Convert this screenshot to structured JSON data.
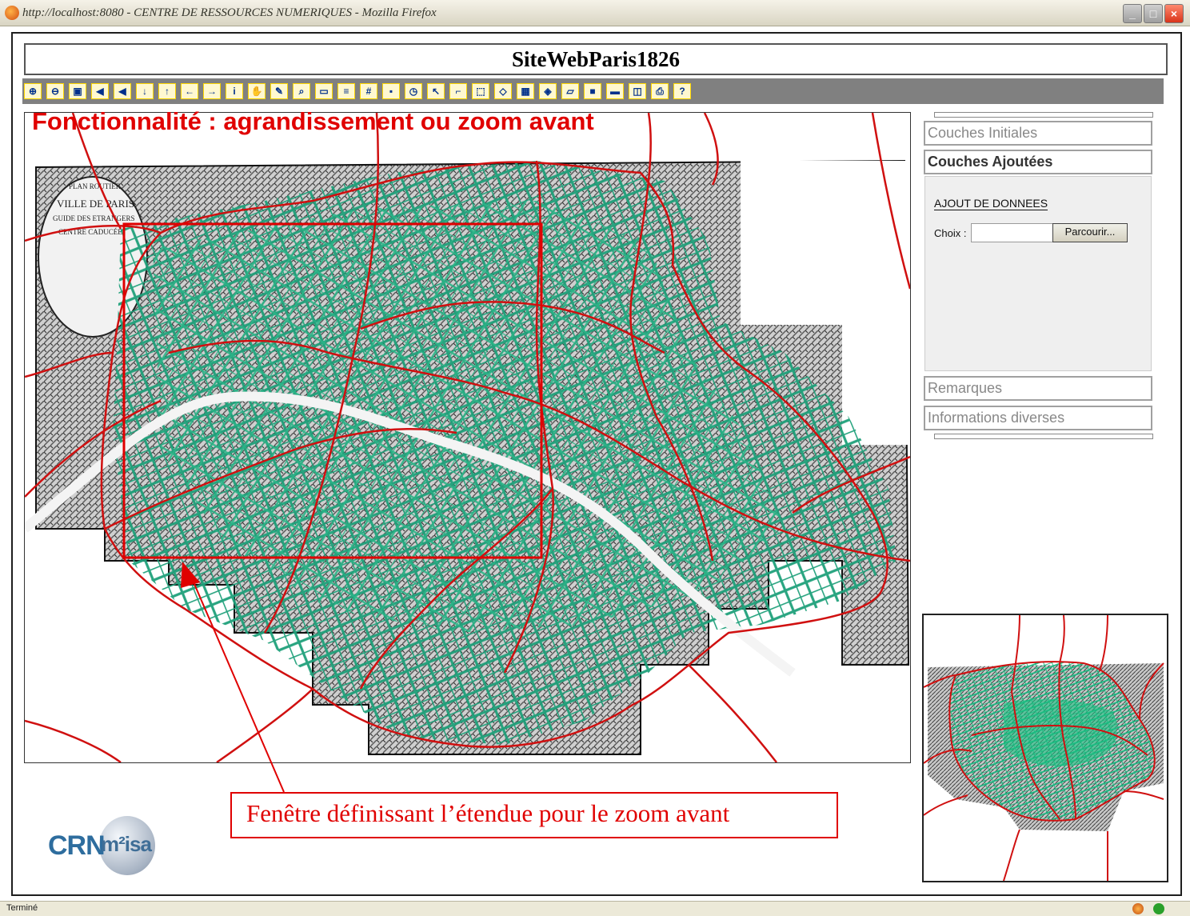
{
  "window": {
    "title": "http://localhost:8080 - CENTRE DE RESSOURCES NUMERIQUES - Mozilla Firefox",
    "status": "Terminé"
  },
  "page": {
    "site_title": "SiteWebParis1826",
    "feature_caption": "Fonctionnalité : agrandissement ou zoom avant",
    "callout_text": "Fenêtre définissant l’étendue pour le zoom avant"
  },
  "toolbar": {
    "tools": [
      {
        "icon": "zoom-in-icon",
        "glyph": "⊕"
      },
      {
        "icon": "zoom-out-icon",
        "glyph": "⊖"
      },
      {
        "icon": "zoom-extent-icon",
        "glyph": "▣"
      },
      {
        "icon": "previous-extent-icon",
        "glyph": "◀"
      },
      {
        "icon": "next-extent-icon",
        "glyph": "◀"
      },
      {
        "icon": "pan-down-icon",
        "glyph": "↓"
      },
      {
        "icon": "pan-up-icon",
        "glyph": "↑"
      },
      {
        "icon": "pan-left-icon",
        "glyph": "←"
      },
      {
        "icon": "pan-right-icon",
        "glyph": "→"
      },
      {
        "icon": "info-icon",
        "glyph": "i"
      },
      {
        "icon": "pan-hand-icon",
        "glyph": "✋"
      },
      {
        "icon": "edit-icon",
        "glyph": "✎"
      },
      {
        "icon": "find-icon",
        "glyph": "⌕"
      },
      {
        "icon": "measure-icon",
        "glyph": "▭"
      },
      {
        "icon": "list-icon",
        "glyph": "≡"
      },
      {
        "icon": "grid-icon",
        "glyph": "#"
      },
      {
        "icon": "bookmark-icon",
        "glyph": "▪"
      },
      {
        "icon": "clock-icon",
        "glyph": "◷"
      },
      {
        "icon": "select-icon",
        "glyph": "↖"
      },
      {
        "icon": "select-line-icon",
        "glyph": "⌐"
      },
      {
        "icon": "select-rect-icon",
        "glyph": "⬚"
      },
      {
        "icon": "eraser-icon",
        "glyph": "◇"
      },
      {
        "icon": "table-icon",
        "glyph": "▦"
      },
      {
        "icon": "layers-icon",
        "glyph": "◈"
      },
      {
        "icon": "open-folder-icon",
        "glyph": "▱"
      },
      {
        "icon": "save-icon",
        "glyph": "■"
      },
      {
        "icon": "folder-icon",
        "glyph": "▬"
      },
      {
        "icon": "export-icon",
        "glyph": "◫"
      },
      {
        "icon": "print-icon",
        "glyph": "⎙"
      },
      {
        "icon": "help-icon",
        "glyph": "?"
      }
    ]
  },
  "right_panel": {
    "couches_initiales": "Couches Initiales",
    "couches_ajoutees": "Couches Ajoutées",
    "ajout_label": "AJOUT DE DONNEES",
    "choix_label": "Choix :",
    "choix_value": "",
    "parcourir_label": "Parcourir...",
    "remarques": "Remarques",
    "informations": "Informations diverses"
  },
  "logo": {
    "crn": "CRN",
    "misa": "m²isa"
  },
  "colors": {
    "annotation_red": "#e00000",
    "street_green": "#1fa07a",
    "boundary_red": "#d01010",
    "toolbar_gray": "#808080"
  }
}
